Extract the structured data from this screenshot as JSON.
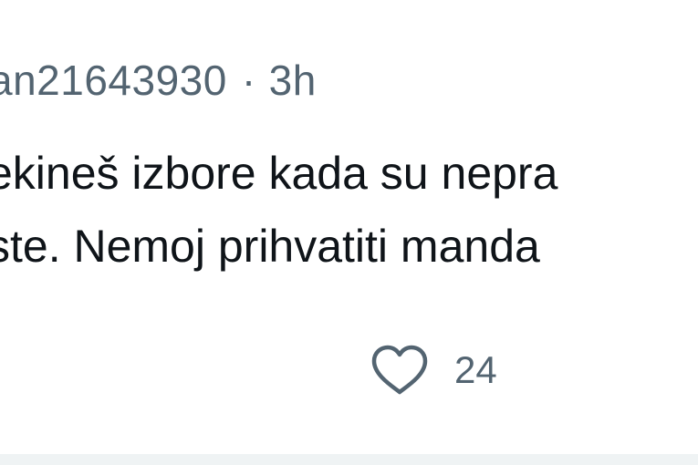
{
  "tweet": {
    "handle": "an21643930",
    "separator": "·",
    "time": "3h",
    "text_lines": [
      "ekineš izbore kada su nepra",
      "ste. Nemoj prihvatiti manda"
    ],
    "like_count": "24"
  },
  "icons": {
    "like": "heart-icon"
  },
  "colors": {
    "text_primary": "#0f1419",
    "text_secondary": "#536471",
    "divider": "#eff3f4"
  }
}
